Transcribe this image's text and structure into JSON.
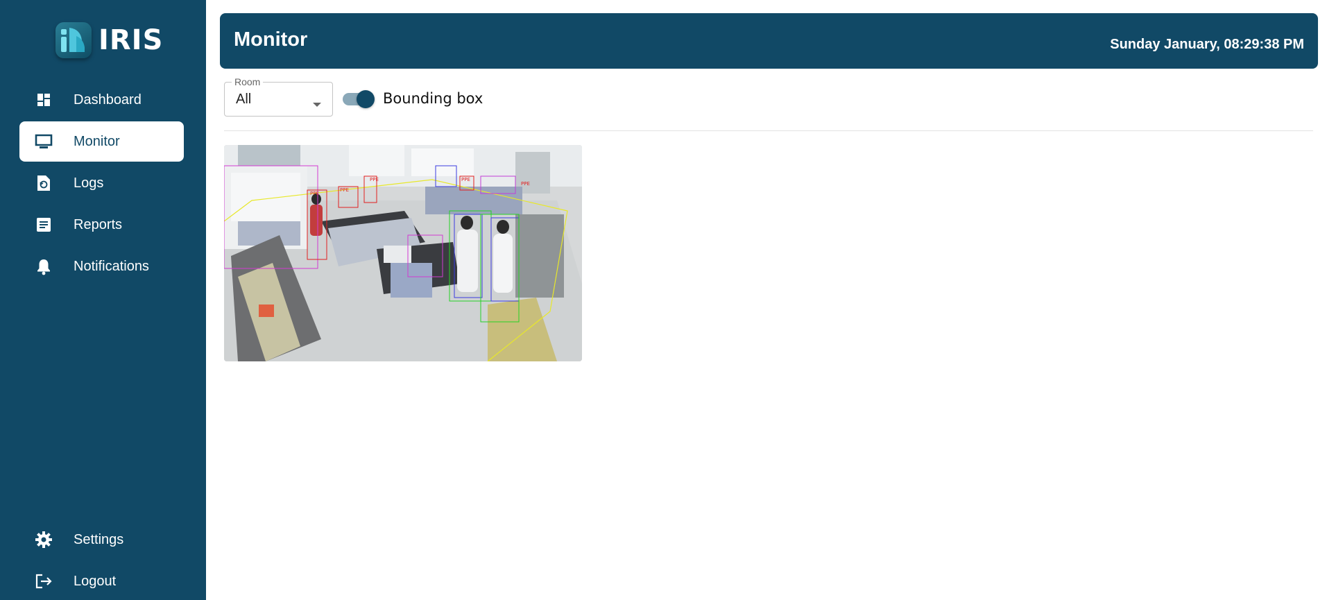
{
  "app": {
    "name": "IRIS"
  },
  "sidebar": {
    "items": [
      {
        "label": "Dashboard",
        "icon": "dashboard-icon"
      },
      {
        "label": "Monitor",
        "icon": "monitor-icon",
        "active": true
      },
      {
        "label": "Logs",
        "icon": "logs-icon"
      },
      {
        "label": "Reports",
        "icon": "reports-icon"
      },
      {
        "label": "Notifications",
        "icon": "bell-icon"
      }
    ],
    "bottom_items": [
      {
        "label": "Settings",
        "icon": "gear-icon"
      },
      {
        "label": "Logout",
        "icon": "logout-icon"
      }
    ]
  },
  "header": {
    "title": "Monitor",
    "datetime": "Sunday January, 08:29:38 PM"
  },
  "filters": {
    "room_label": "Room",
    "room_value": "All",
    "bounding_box_label": "Bounding box",
    "bounding_box_enabled": true
  },
  "camera_feed": {
    "count": 1,
    "overlay_labels": [
      "PPE",
      "PPE",
      "PPE",
      "PPE",
      "PPE"
    ]
  },
  "colors": {
    "primary": "#114966",
    "background": "#ffffff",
    "toggle_track": "#8aa8b8"
  }
}
